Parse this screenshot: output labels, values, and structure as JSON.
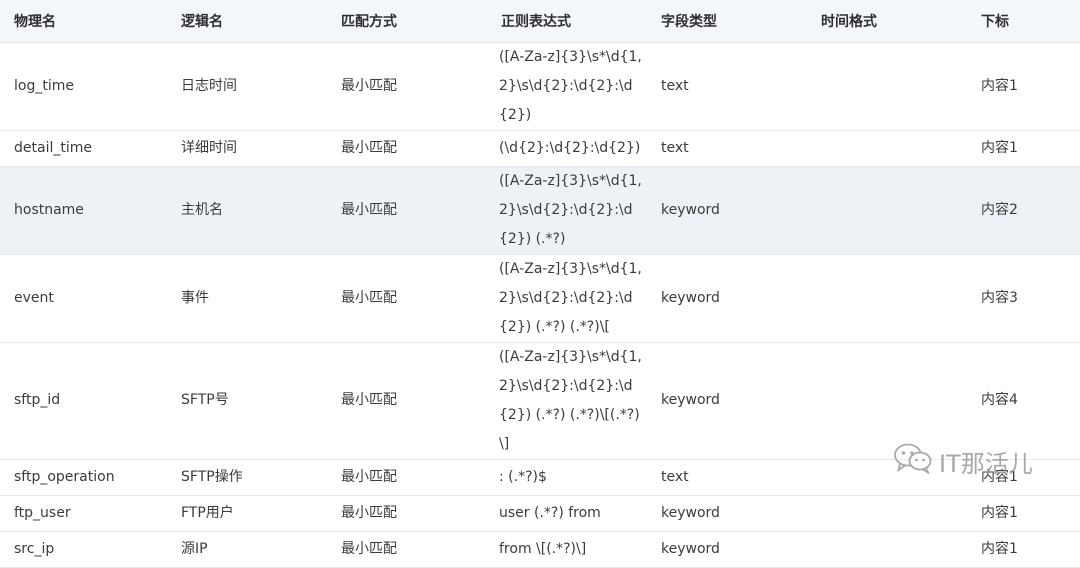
{
  "headers": [
    "物理名",
    "逻辑名",
    "匹配方式",
    "正则表达式",
    "字段类型",
    "时间格式",
    "下标"
  ],
  "rows": [
    {
      "physical": "log_time",
      "logical": "日志时间",
      "match": "最小匹配",
      "regex": "([A-Za-z]{3}\\s*\\d{1,2}\\s\\d{2}:\\d{2}:\\d{2})",
      "type": "text",
      "time_format": "",
      "index": "内容1"
    },
    {
      "physical": "detail_time",
      "logical": "详细时间",
      "match": "最小匹配",
      "regex": "(\\d{2}:\\d{2}:\\d{2})",
      "type": "text",
      "time_format": "",
      "index": "内容1"
    },
    {
      "physical": "hostname",
      "logical": "主机名",
      "match": "最小匹配",
      "regex": "([A-Za-z]{3}\\s*\\d{1,2}\\s\\d{2}:\\d{2}:\\d{2}) (.*?)",
      "type": "keyword",
      "time_format": "",
      "index": "内容2"
    },
    {
      "physical": "event",
      "logical": "事件",
      "match": "最小匹配",
      "regex": "([A-Za-z]{3}\\s*\\d{1,2}\\s\\d{2}:\\d{2}:\\d{2}) (.*?) (.*?)\\[",
      "type": "keyword",
      "time_format": "",
      "index": "内容3"
    },
    {
      "physical": "sftp_id",
      "logical": "SFTP号",
      "match": "最小匹配",
      "regex": "([A-Za-z]{3}\\s*\\d{1,2}\\s\\d{2}:\\d{2}:\\d{2}) (.*?) (.*?)\\[(.*?)\\]",
      "type": "keyword",
      "time_format": "",
      "index": "内容4"
    },
    {
      "physical": "sftp_operation",
      "logical": "SFTP操作",
      "match": "最小匹配",
      "regex": ": (.*?)$",
      "type": "text",
      "time_format": "",
      "index": "内容1"
    },
    {
      "physical": "ftp_user",
      "logical": "FTP用户",
      "match": "最小匹配",
      "regex": "user (.*?) from",
      "type": "keyword",
      "time_format": "",
      "index": "内容1"
    },
    {
      "physical": "src_ip",
      "logical": "源IP",
      "match": "最小匹配",
      "regex": "from \\[(.*?)\\]",
      "type": "keyword",
      "time_format": "",
      "index": "内容1"
    }
  ],
  "watermark": {
    "text": "IT那活儿",
    "icon": "wechat-icon"
  }
}
